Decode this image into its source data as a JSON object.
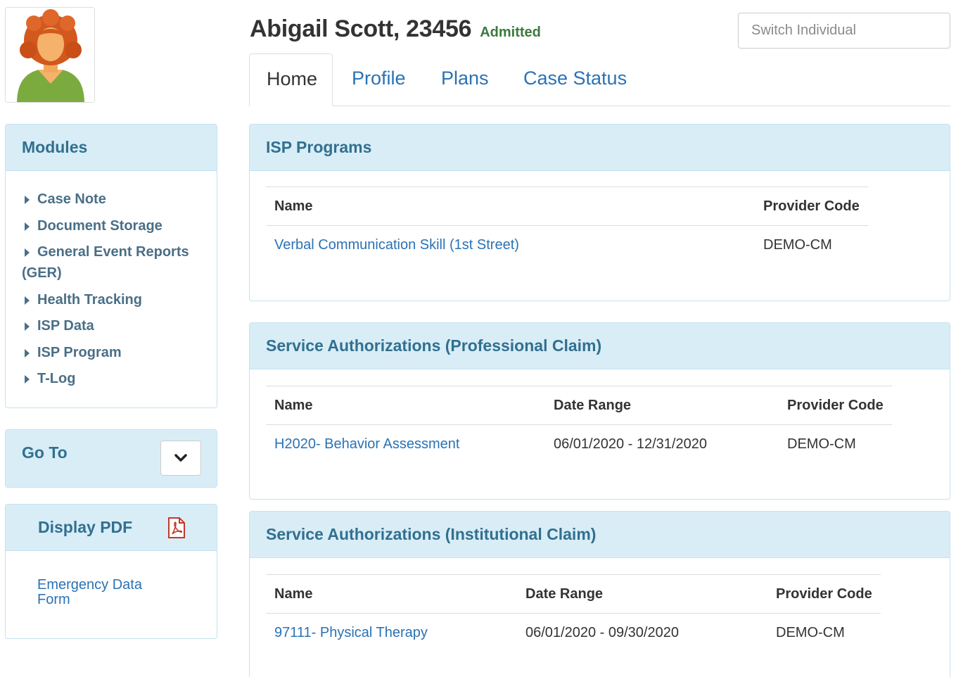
{
  "header": {
    "name": "Abigail Scott, 23456",
    "status": "Admitted",
    "switch_placeholder": "Switch Individual"
  },
  "tabs": [
    {
      "label": "Home",
      "active": true
    },
    {
      "label": "Profile",
      "active": false
    },
    {
      "label": "Plans",
      "active": false
    },
    {
      "label": "Case Status",
      "active": false
    }
  ],
  "sidebar": {
    "modules_title": "Modules",
    "modules": [
      "Case Note",
      "Document Storage",
      "General Event Reports (GER)",
      "Health Tracking",
      "ISP Data",
      "ISP Program",
      "T-Log"
    ],
    "goto_title": "Go To",
    "pdf_title": "Display PDF",
    "pdf_link": "Emergency Data Form"
  },
  "isp_programs": {
    "title": "ISP Programs",
    "columns": [
      "Name",
      "Provider Code"
    ],
    "rows": [
      [
        "Verbal Communication Skill (1st Street)",
        "DEMO-CM"
      ]
    ]
  },
  "sa_professional": {
    "title": "Service Authorizations (Professional Claim)",
    "columns": [
      "Name",
      "Date Range",
      "Provider Code"
    ],
    "rows": [
      [
        "H2020- Behavior Assessment",
        "06/01/2020 - 12/31/2020",
        "DEMO-CM"
      ]
    ]
  },
  "sa_institutional": {
    "title": "Service Authorizations (Institutional Claim)",
    "columns": [
      "Name",
      "Date Range",
      "Provider Code"
    ],
    "rows": [
      [
        "97111- Physical Therapy",
        "06/01/2020 - 09/30/2020",
        "DEMO-CM"
      ]
    ]
  },
  "colors": {
    "link": "#2a72b5",
    "panel_heading_bg": "#d9edf7",
    "panel_heading_text": "#31708f",
    "status_green": "#3c7a3c",
    "pdf_icon": "#c0392b"
  }
}
